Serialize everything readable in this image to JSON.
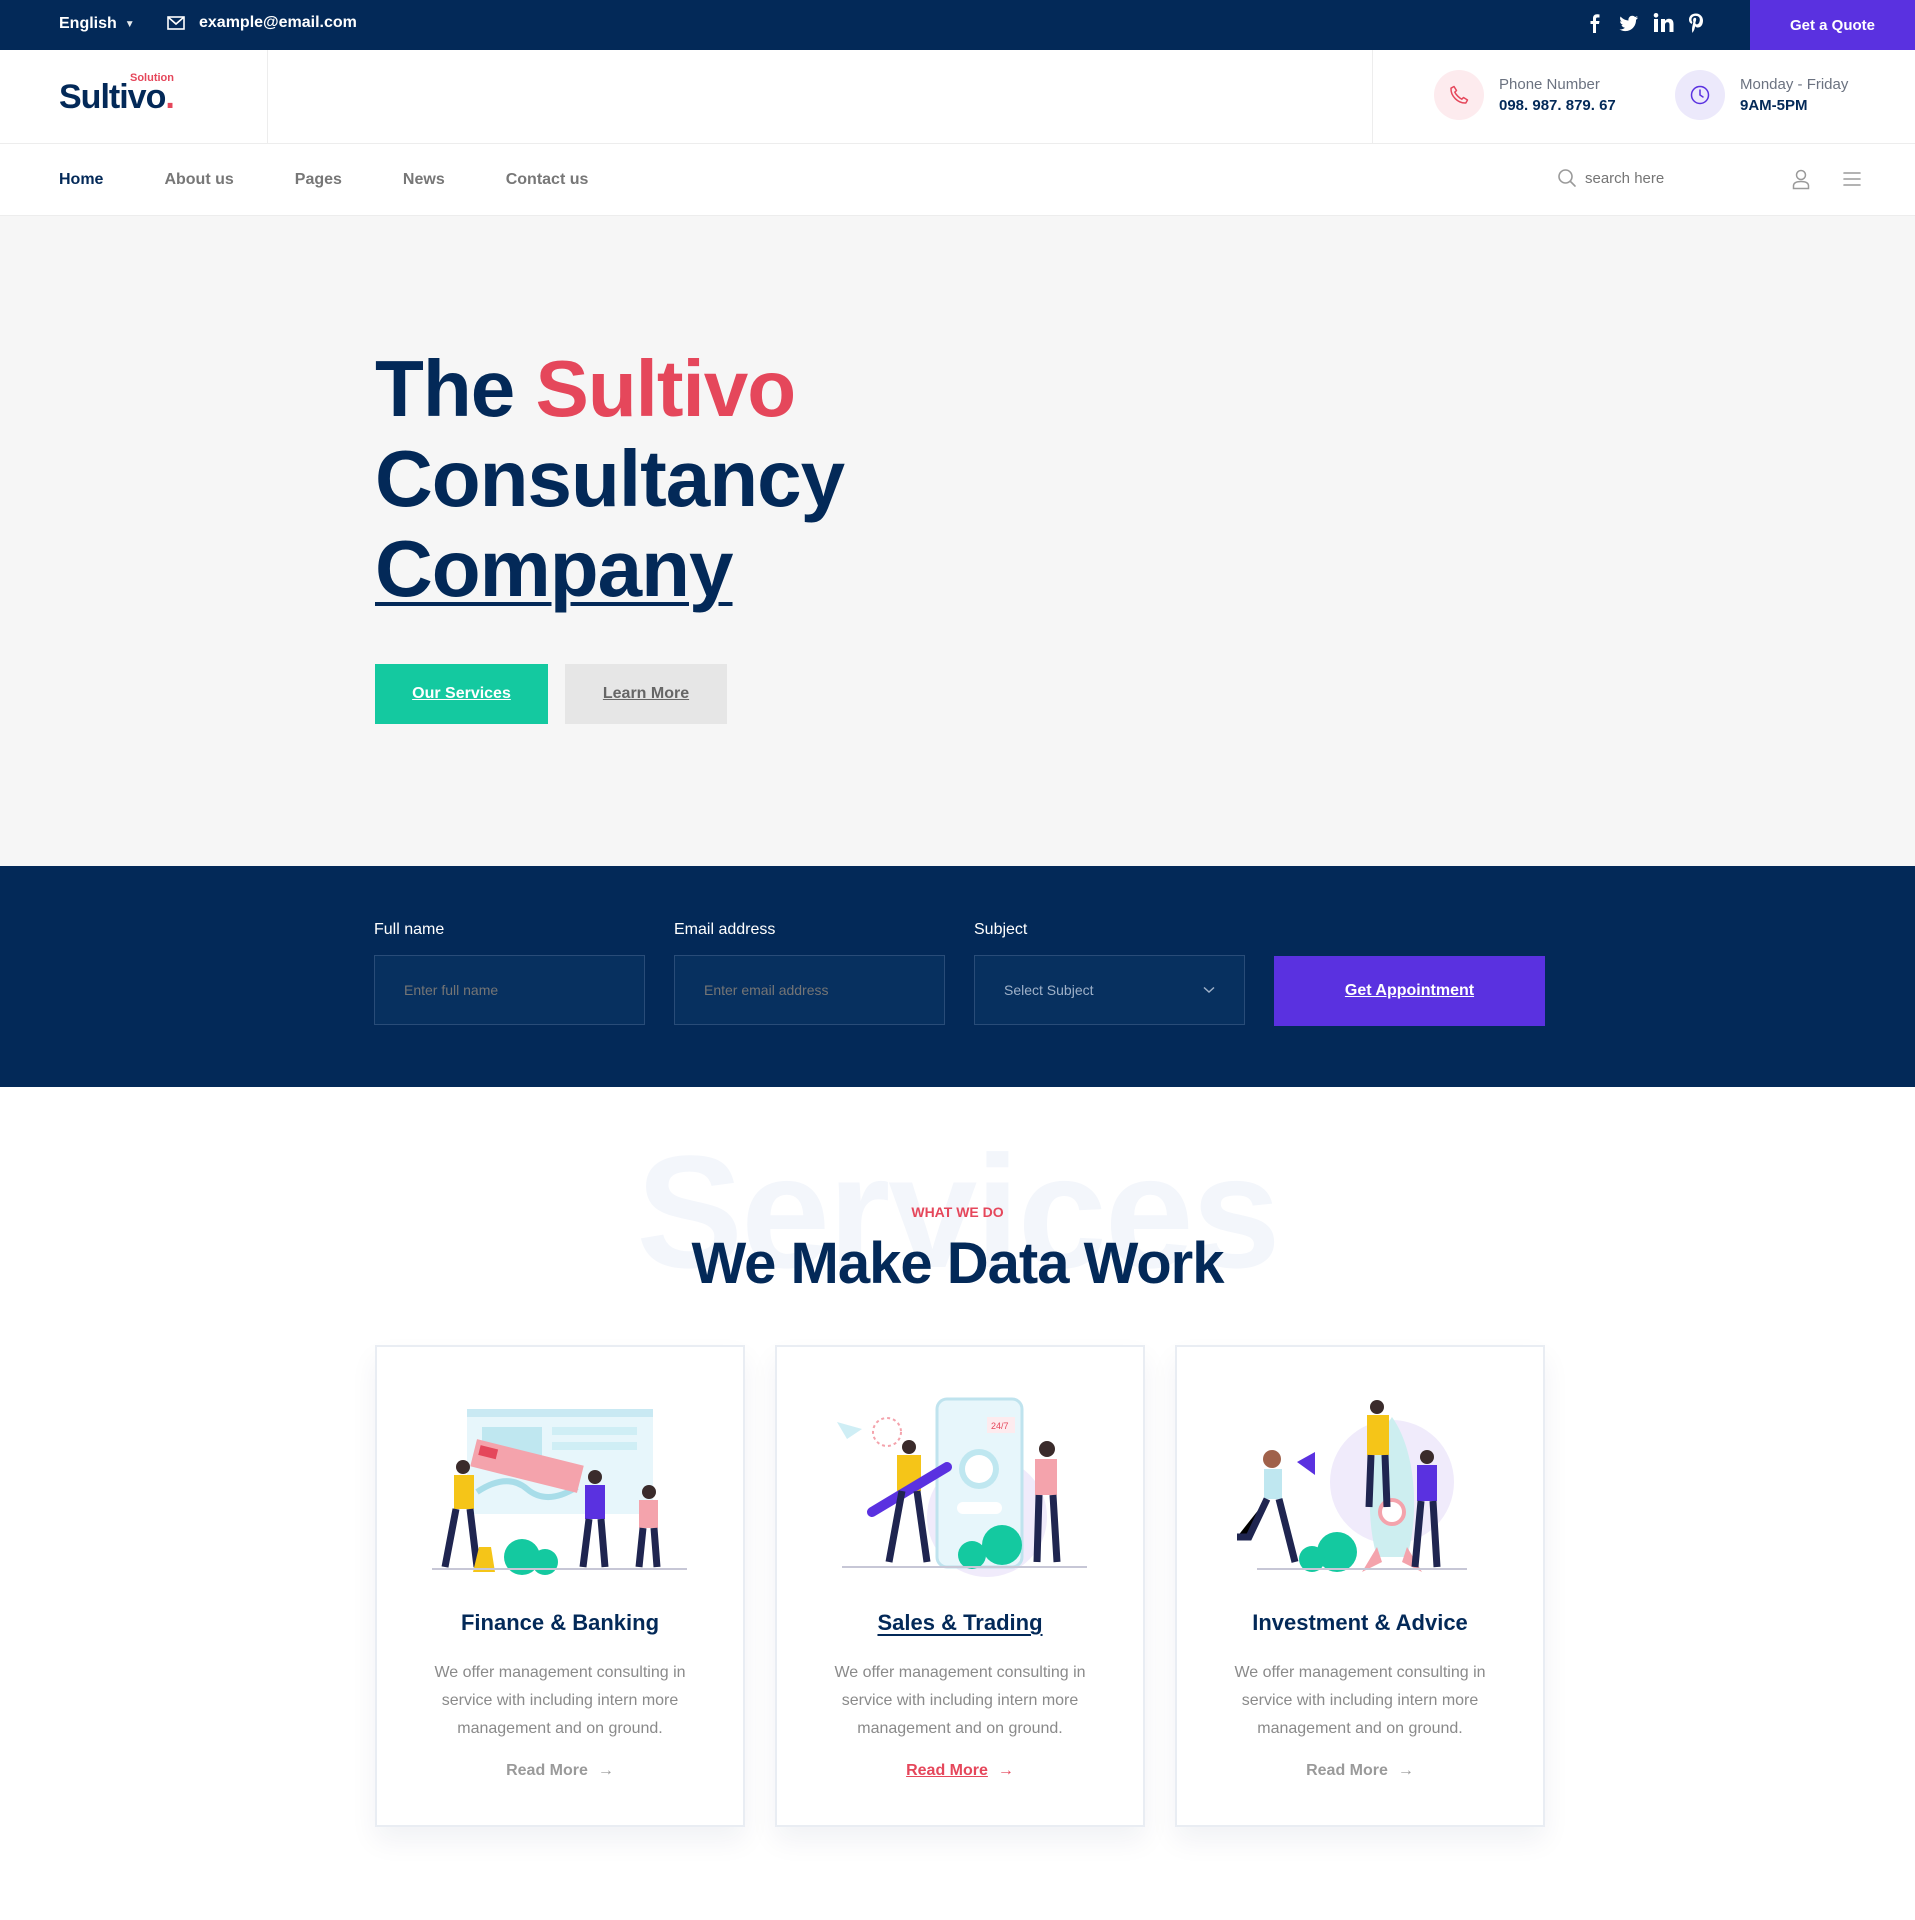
{
  "topbar": {
    "language": "English",
    "email": "example@email.com",
    "socials": [
      "facebook-icon",
      "twitter-icon",
      "linkedin-icon",
      "pinterest-icon"
    ],
    "quote_label": "Get a Quote"
  },
  "header": {
    "logo_text": "Sultivo",
    "logo_dot": ".",
    "logo_sub": "Solution",
    "phone_label": "Phone Number",
    "phone_value": "098. 987. 879. 67",
    "hours_label": "Monday - Friday",
    "hours_value": "9AM-5PM"
  },
  "nav": {
    "items": [
      "Home",
      "About us",
      "Pages",
      "News",
      "Contact us"
    ],
    "search_placeholder": "search here"
  },
  "hero": {
    "line1_a": "The ",
    "line1_b": "Sultivo",
    "line2": "Consultancy",
    "line3": "Company",
    "btn_services": "Our Services",
    "btn_learn": "Learn More"
  },
  "appointment": {
    "name_label": "Full name",
    "name_placeholder": "Enter full name",
    "email_label": "Email address",
    "email_placeholder": "Enter email address",
    "subject_label": "Subject",
    "subject_value": "Select Subject",
    "submit_label": "Get Appointment"
  },
  "services": {
    "watermark": "Services",
    "eyebrow": "WHAT WE DO",
    "title": "We Make Data Work",
    "cards": [
      {
        "title": "Finance & Banking",
        "text": "We offer management consulting in service with including intern more management and on ground.",
        "more": "Read More"
      },
      {
        "title": "Sales & Trading",
        "text": "We offer management consulting in service with including intern more management and on ground.",
        "more": "Read More"
      },
      {
        "title": "Investment & Advice",
        "text": "We offer management consulting in service with including intern more management and on ground.",
        "more": "Read More"
      }
    ]
  },
  "colors": {
    "navy": "#032958",
    "accent_red": "#e5475b",
    "purple": "#5a31e0",
    "teal": "#14c9a0"
  }
}
